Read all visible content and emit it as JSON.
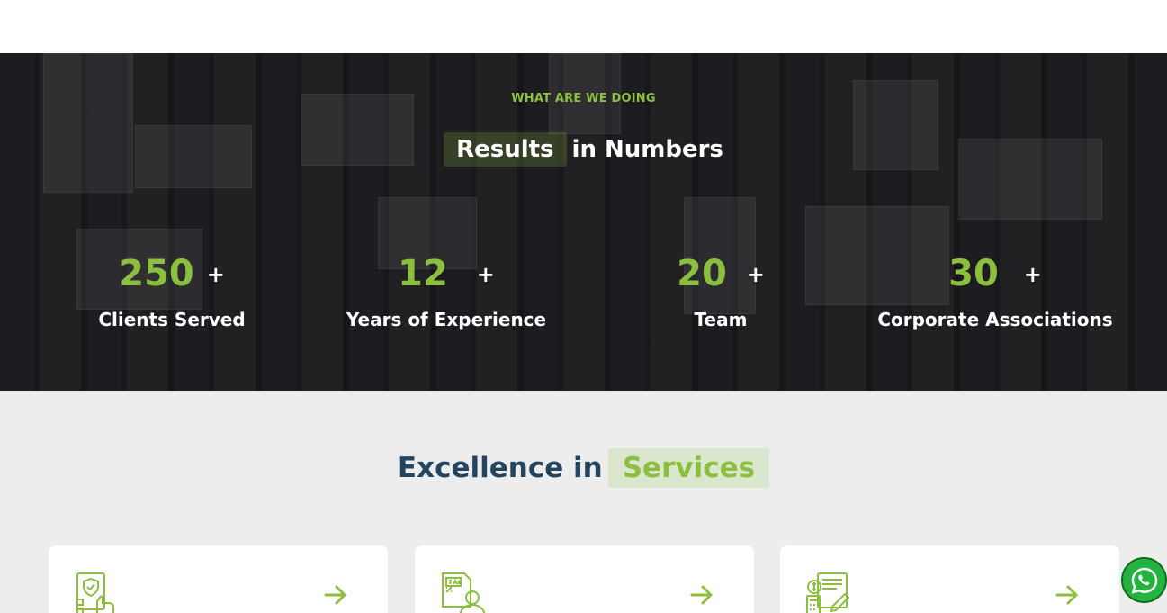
{
  "stats_section": {
    "eyebrow": "WHAT ARE WE DOING",
    "heading_highlight": "Results",
    "heading_rest": "in Numbers",
    "items": [
      {
        "number": "250",
        "suffix": "+",
        "label": "Clients Served"
      },
      {
        "number": "12",
        "suffix": "+",
        "label": "Years of Experience"
      },
      {
        "number": "20",
        "suffix": "+",
        "label": "Team"
      },
      {
        "number": "30",
        "suffix": "+",
        "label": "Corporate Associations"
      }
    ]
  },
  "services_section": {
    "title_prefix": "Excellence in",
    "title_highlight": "Services",
    "cards": [
      {
        "icon": "shield-checklist-icon"
      },
      {
        "icon": "tax-document-icon"
      },
      {
        "icon": "finance-calculator-icon"
      }
    ]
  },
  "floating": {
    "icon": "whatsapp-icon"
  },
  "colors": {
    "accent_green": "#8dbf3f",
    "heading_navy": "#24455f",
    "services_bg": "#ededed",
    "whatsapp_green": "#25b33f"
  }
}
